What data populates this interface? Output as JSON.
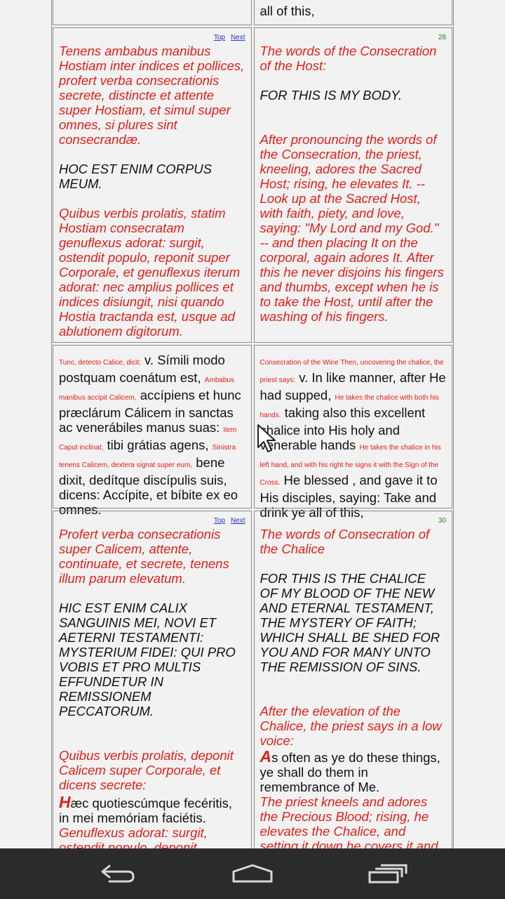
{
  "rows": [
    {
      "left_text": "",
      "right_text": "all of this,"
    },
    {
      "left_nav": {
        "top": "Top",
        "next": "Next"
      },
      "right_num": "28",
      "left_red1": "Tenens ambabus manibus Hostiam inter indices et pollices, profert verba consecrationis secrete, distincte et attente super Hostiam, et simul super omnes, si plures sint consecrandæ.",
      "left_black": "HOC EST ENIM CORPUS MEUM.",
      "left_red2": "Quibus verbis prolatis, statim Hostiam consecratam genuflexus adorat: surgit, ostendit populo, reponit super Corporale, et genuflexus iterum adorat: nec amplius pollices et indices disiungit, nisi quando Hostia tractanda est, usque ad ablutionem digitorum.",
      "right_red1": "The words of the Consecration of the Host:",
      "right_black": "FOR THIS IS MY BODY.",
      "right_red2": "After pronouncing the words of the Consecration, the priest, kneeling, adores the Sacred Host; rising, he elevates It. -- Look up at the Sacred Host, with faith, piety, and love, saying: \"My Lord and my God.\" -- and then placing It on the corporal, again adores It. After this he never disjoins his fingers and thumbs, except when he is to take the Host, until after the washing of his fingers."
    },
    {
      "left": {
        "s1": "Tunc, detecto Calice, dicit:",
        "t1": " v. Símili modo postquam coenátum est, ",
        "s2": "Ambabus manibus accipit Calicem,",
        "t2": " accípiens et hunc præclárum Cálicem in sanctas ac venerábiles manus suas: ",
        "s3": "item Caput inclinat,",
        "t3": " tibi grátias agens, ",
        "s4": "Sinistra tenens Calicem, dextera signat super eum,",
        "t4": " bene dixit, dedítque discípulis suis, dicens: Accípite, et bíbite ex eo omnes."
      },
      "right": {
        "s1": "Consecration of the Wine Then, uncovering the chalice, the priest says:",
        "t1": " v. In like manner, after He had supped, ",
        "s2": "He takes the chalice with both his hands.",
        "t2": " taking also this excellent chalice into His holy and venerable hands ",
        "s3": "He takes the chalice in his left hand, and with his right he signs it with the Sign of the Cross.",
        "t3": " He blessed   , and gave it to His disciples, saying: Take and drink ye all of this,"
      }
    },
    {
      "left_nav": {
        "top": "Top",
        "next": "Next"
      },
      "right_num": "30",
      "left_red1": "Profert verba consecrationis super Calicem, attente, continuate, et secrete, tenens illum parum elevatum.",
      "left_black": "HIC EST ENIM CALIX SANGUINIS MEI, NOVI ET AETERNI TESTAMENTI: MYSTERIUM FIDEI: QUI PRO VOBIS ET PRO MULTIS EFFUNDETUR IN REMISSIONEM PECCATORUM.",
      "left_red2": "Quibus verbis prolatis, deponit Calicem super Corporale, et dicens secrete:",
      "left_drop": "H",
      "left_body": "æc quotiescúmque fecéritis, in mei memóriam faciétis.",
      "left_red3": "Genuflexus adorat: surgit, ostendit populo, deponit, cooperit, et genuflexus iterum adorat.",
      "right_red1": "The words of Consecration of the Chalice",
      "right_black": "FOR THIS IS THE CHALICE OF MY BLOOD OF THE NEW AND ETERNAL TESTAMENT, THE MYSTERY OF FAITH; WHICH SHALL BE SHED FOR YOU AND FOR MANY UNTO THE REMISSION OF SINS.",
      "right_red2": "After the elevation of the Chalice, the priest says in a low voice:",
      "right_drop": "A",
      "right_body": "s often as ye do these things, ye shall do them in remembrance of Me.",
      "right_red3": "The priest kneels and adores the Precious Blood; rising, he elevates the Chalice, and setting it down he covers it and adores it again."
    }
  ],
  "navbar": {
    "back": "back-icon",
    "home": "home-icon",
    "recents": "recents-icon"
  }
}
